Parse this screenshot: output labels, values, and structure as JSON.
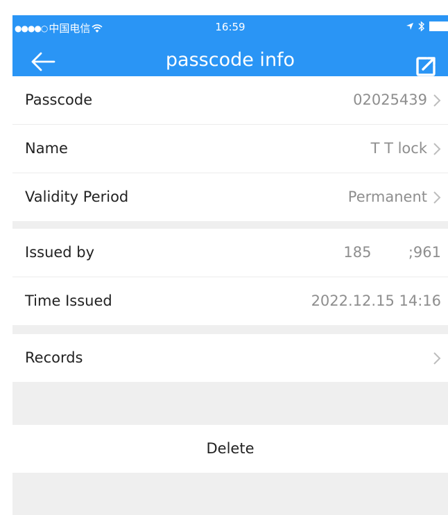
{
  "status_bar": {
    "signal_dots": "●●●●○",
    "carrier": "中国电信",
    "time": "16:59"
  },
  "nav": {
    "title": "passcode info"
  },
  "section1": [
    {
      "label": "Passcode",
      "value": "02025439"
    },
    {
      "label": "Name",
      "value": "T T lock"
    },
    {
      "label": "Validity Period",
      "value": "Permanent"
    }
  ],
  "section2": [
    {
      "label": "Issued by",
      "value": "185        ;961"
    },
    {
      "label": "Time Issued",
      "value": "2022.12.15 14:16"
    }
  ],
  "section3": [
    {
      "label": "Records"
    }
  ],
  "delete_label": "Delete",
  "colors": {
    "accent": "#2a95f5",
    "background": "#efefef",
    "value_text": "#8e8e8e"
  }
}
